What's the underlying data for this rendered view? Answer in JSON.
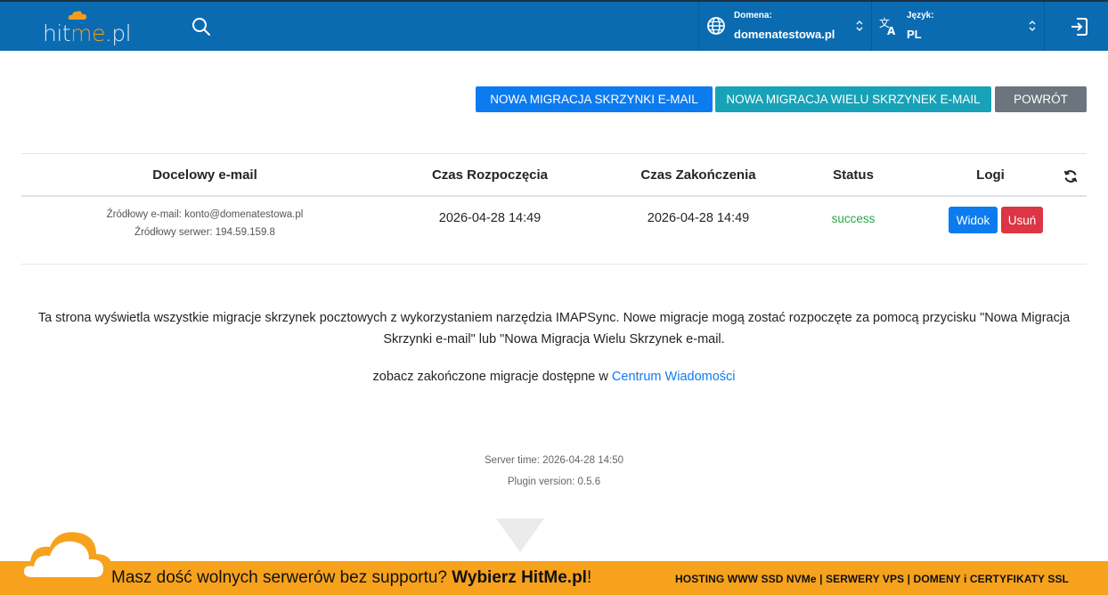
{
  "header": {
    "logo_prefix": "hit",
    "logo_accent": "me",
    "logo_suffix": ".pl",
    "domain_label": "Domena:",
    "domain_value": "domenatestowa.pl",
    "language_label": "Język:",
    "language_value": "PL",
    "bar_color": "#0b6bb1"
  },
  "actions": {
    "new_migration": "NOWA MIGRACJA SKRZYNKI E-MAIL",
    "new_multi_migration": "NOWA MIGRACJA WIELU SKRZYNEK E-MAIL",
    "back": "POWRÓT"
  },
  "table": {
    "columns": [
      "Docelowy e-mail",
      "Czas Rozpoczęcia",
      "Czas Zakończenia",
      "Status",
      "Logi"
    ],
    "rows": [
      {
        "source_email": "Źródłowy e-mail: konto@domenatestowa.pl",
        "source_server": "Źródłowy serwer: 194.59.159.8",
        "start": "2026-04-28 14:49",
        "end": "2026-04-28 14:49",
        "status": "success",
        "view_label": "Widok",
        "delete_label": "Usuń"
      }
    ]
  },
  "info": {
    "description": "Ta strona wyświetla wszystkie migracje skrzynek pocztowych z wykorzystaniem narzędzia IMAPSync. Nowe migracje mogą zostać rozpoczęte za pomocą przycisku \"Nowa Migracja Skrzynki e-mail\" lub \"Nowa Migracja Wielu Skrzynek e-mail.",
    "see_prefix": "zobacz zakończone migracje dostępne w ",
    "see_link": "Centrum Wiadomości"
  },
  "footer": {
    "server_time": "Server time: 2026-04-28 14:50",
    "plugin_version": "Plugin version: 0.5.6"
  },
  "banner": {
    "left_text": "Masz dość wolnych serwerów bez supportu? ",
    "left_bold": "Wybierz HitMe.pl",
    "left_end": "!",
    "right_text": "HOSTING WWW SSD NVMe | SERWERY VPS | DOMENY i CERTYFIKATY SSL",
    "color": "#f7a21c"
  }
}
